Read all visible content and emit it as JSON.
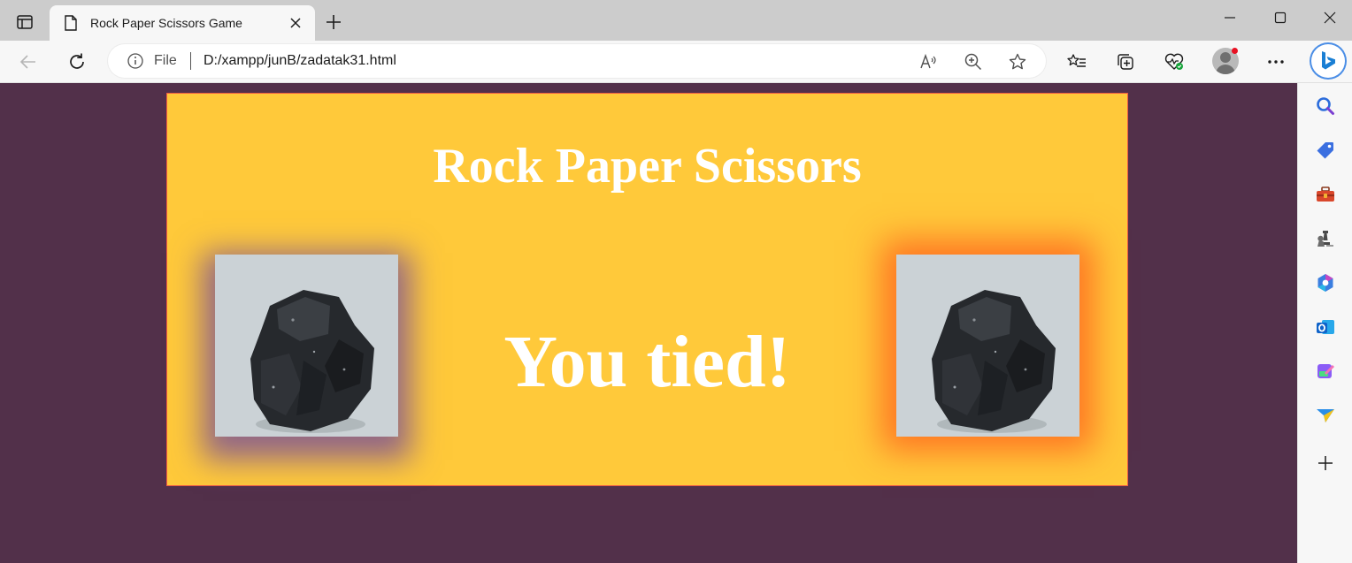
{
  "browser": {
    "tab_title": "Rock Paper Scissors Game",
    "address": {
      "scheme_label": "File",
      "url": "D:/xampp/junB/zadatak31.html"
    }
  },
  "game": {
    "title": "Rock Paper Scissors",
    "result": "You tied!",
    "player_choice": "rock",
    "computer_choice": "rock",
    "colors": {
      "page_background": "#52304a",
      "panel_background": "#ffc93a",
      "panel_border": "#ef5b43",
      "player_glow": "#6e46a0",
      "computer_glow": "#ff641e"
    }
  },
  "icons": {
    "tab_actions": "tab-actions-icon",
    "tab_page": "document-icon",
    "sidebar": [
      "search-icon",
      "tag-icon",
      "toolbox-icon",
      "chess-icon",
      "microsoft-365-icon",
      "outlook-icon",
      "designer-icon",
      "send-icon",
      "add-icon"
    ]
  }
}
